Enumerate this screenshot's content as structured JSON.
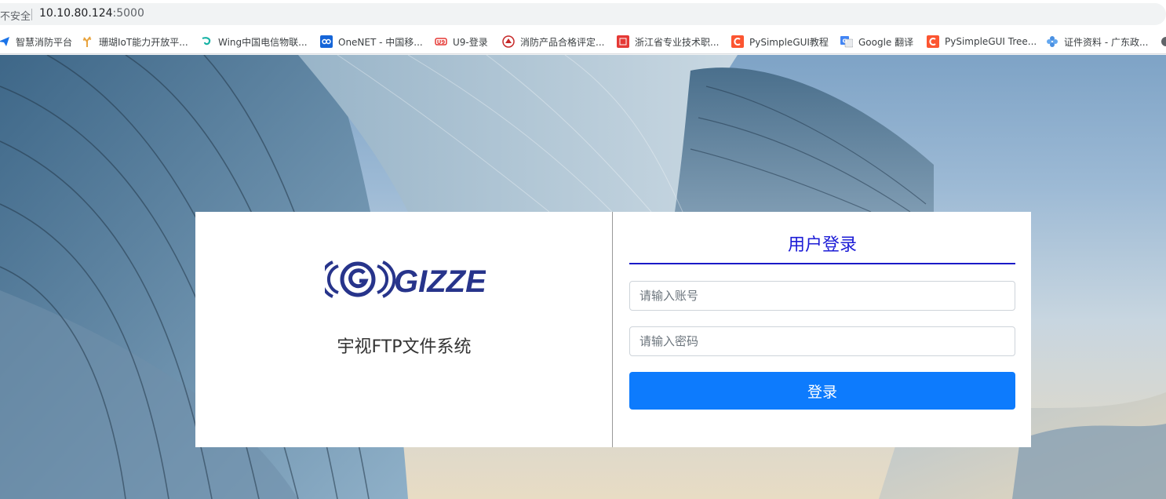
{
  "browser": {
    "security_label": "不安全",
    "url_host": "10.10.80.124",
    "url_port": ":5000"
  },
  "bookmarks": [
    {
      "label": "智慧消防平台",
      "icon": "paper-plane-icon",
      "color": "#1a73e8"
    },
    {
      "label": "珊瑚IoT能力开放平...",
      "icon": "coral-icon",
      "color": "#e8a33d"
    },
    {
      "label": "Wing中国电信物联...",
      "icon": "swirl-icon",
      "color": "#19b3a6"
    },
    {
      "label": "OneNET - 中国移...",
      "icon": "onenet-icon",
      "color": "#1565d8"
    },
    {
      "label": "U9-登录",
      "icon": "u9-icon",
      "color": "#e53935"
    },
    {
      "label": "消防产品合格评定...",
      "icon": "shield-badge-icon",
      "color": "#c62828"
    },
    {
      "label": "浙江省专业技术职...",
      "icon": "zhejiang-icon",
      "color": "#e53935"
    },
    {
      "label": "PySimpleGUI教程",
      "icon": "csdn-icon",
      "color": "#fc5531"
    },
    {
      "label": "Google 翻译",
      "icon": "google-translate-icon",
      "color": "#4285f4"
    },
    {
      "label": "PySimpleGUI Tree...",
      "icon": "csdn-icon",
      "color": "#fc5531"
    },
    {
      "label": "证件资料 - 广东政...",
      "icon": "flower-icon",
      "color": "#4a90e2"
    }
  ],
  "login": {
    "brand_text": "GIZZE",
    "system_title": "宇视FTP文件系统",
    "panel_title": "用户登录",
    "username_placeholder": "请输入账号",
    "password_placeholder": "请输入密码",
    "submit_label": "登录"
  },
  "colors": {
    "accent_blue": "#0d7bfd",
    "title_blue": "#1c1cd6",
    "logo_navy": "#27348b"
  }
}
